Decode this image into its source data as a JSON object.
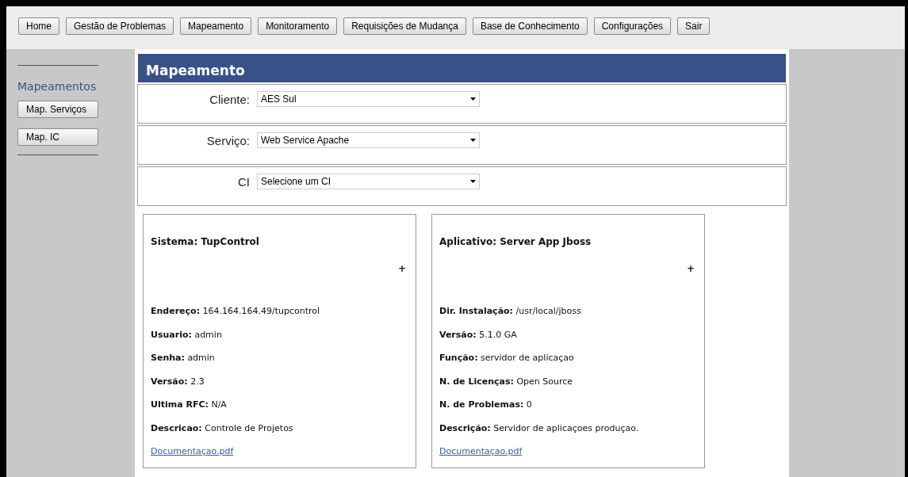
{
  "nav": [
    {
      "label": "Home"
    },
    {
      "label": "Gestão de Problemas"
    },
    {
      "label": "Mapeamento"
    },
    {
      "label": "Monitoramento"
    },
    {
      "label": "Requisições de Mudança"
    },
    {
      "label": "Base de Conhecimento"
    },
    {
      "label": "Configurações"
    },
    {
      "label": "Sair"
    }
  ],
  "sidebar": {
    "title": "Mapeamentos",
    "buttons": [
      "Map. Serviços",
      "Map. IC"
    ]
  },
  "page_title": "Mapeamento",
  "selects": [
    {
      "label": "Cliente:",
      "value": "AES Sul"
    },
    {
      "label": "Serviço:",
      "value": "Web Service Apache"
    },
    {
      "label": "CI",
      "value": "Selecione um CI"
    }
  ],
  "cards": [
    {
      "title": "Sistema: TupControl",
      "expand": "+",
      "fields": [
        {
          "label": "Endereço:",
          "value": "164.164.164.49/tupcontrol"
        },
        {
          "label": "Usuario:",
          "value": "admin"
        },
        {
          "label": "Senha:",
          "value": "admin"
        },
        {
          "label": "Versão:",
          "value": "2.3"
        },
        {
          "label": "Ultima RFC:",
          "value": "N/A"
        },
        {
          "label": "Descricao:",
          "value": "Controle de Projetos"
        }
      ],
      "link": "Documentaçao.pdf"
    },
    {
      "title": "Aplicativo: Server App Jboss",
      "expand": "+",
      "fields": [
        {
          "label": "Dir. Instalação:",
          "value": "/usr/local/jboss"
        },
        {
          "label": "Versão:",
          "value": "5.1.0 GA"
        },
        {
          "label": "Função:",
          "value": "servidor de aplicaçao"
        },
        {
          "label": "N. de Licenças:",
          "value": "Open Source"
        },
        {
          "label": "N. de Problemas:",
          "value": "0"
        },
        {
          "label": "Descrição:",
          "value": "Servidor de aplicaçoes produçao."
        }
      ],
      "link": "Documentaçao.pdf"
    }
  ]
}
